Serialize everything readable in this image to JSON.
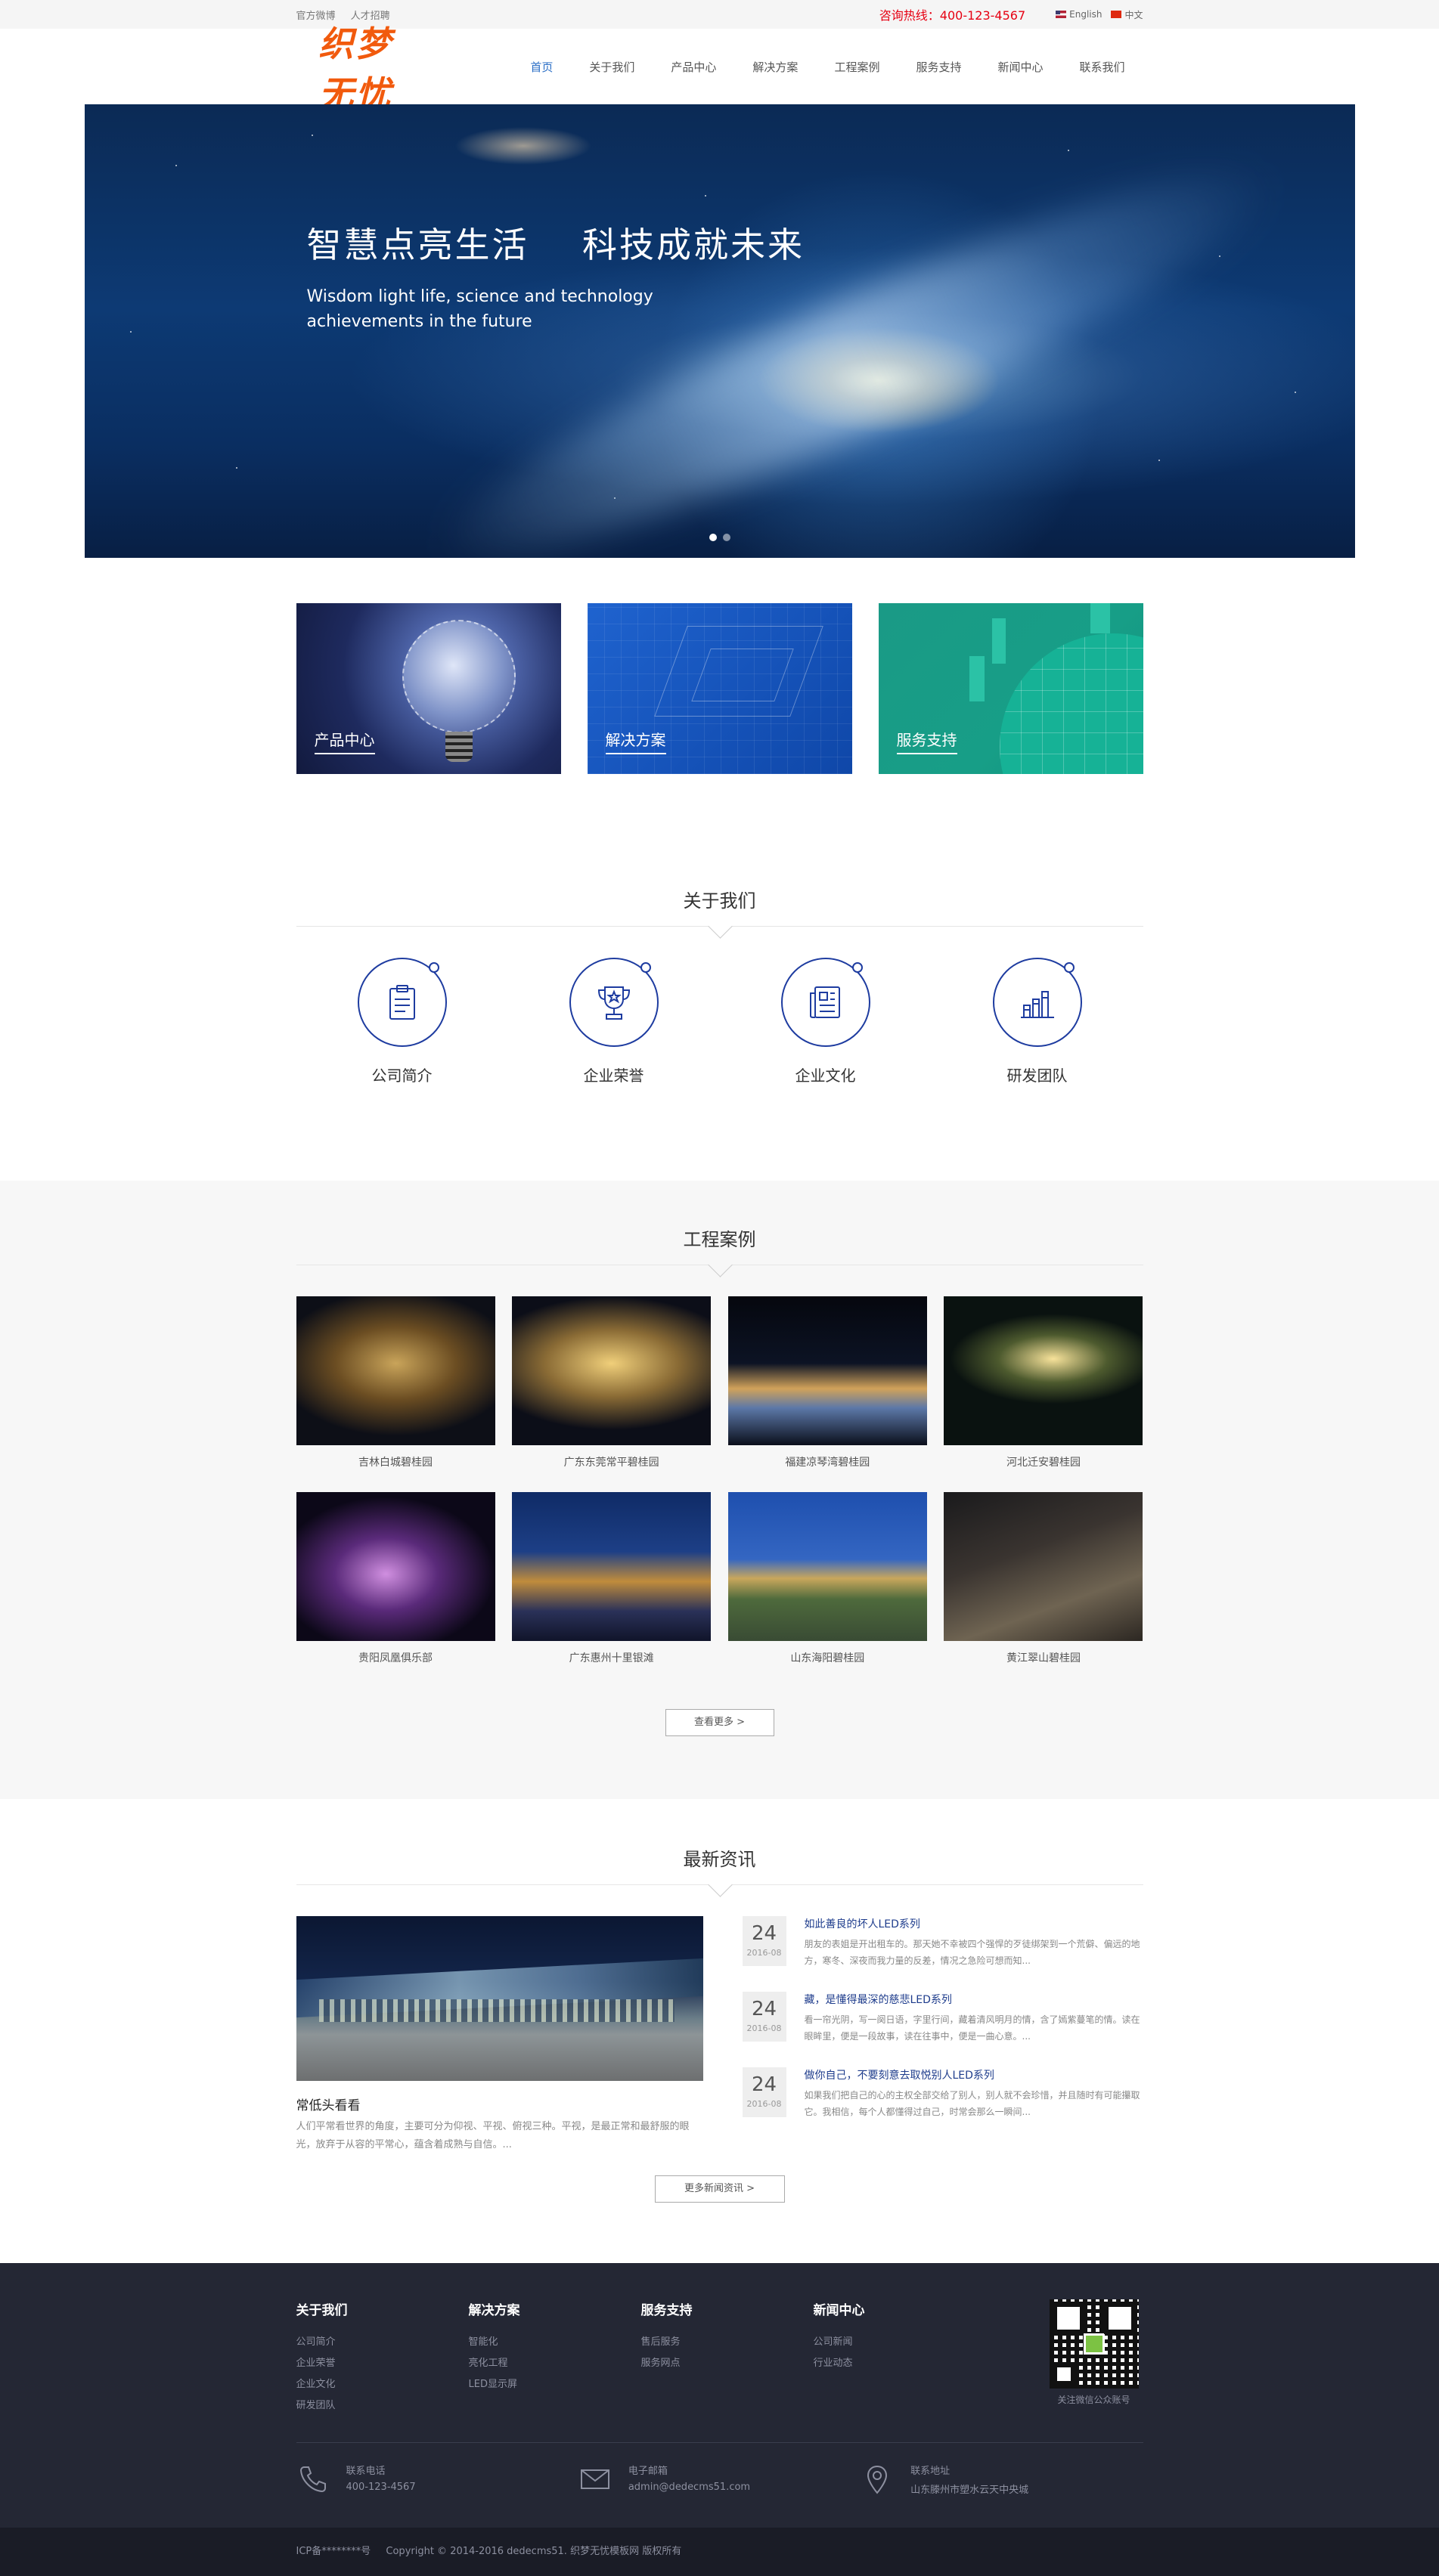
{
  "topbar": {
    "links": [
      "官方微博",
      "人才招聘"
    ],
    "hotline": "咨询热线：400-123-4567",
    "lang_en": "English",
    "lang_cn": "中文"
  },
  "header": {
    "logo": "织梦无忧",
    "nav": [
      "首页",
      "关于我们",
      "产品中心",
      "解决方案",
      "工程案例",
      "服务支持",
      "新闻中心",
      "联系我们"
    ]
  },
  "banner": {
    "title": "智慧点亮生活    科技成就未来",
    "subtitle": "Wisdom light life, science and technology achievements in the future"
  },
  "feature_cards": [
    "产品中心",
    "解决方案",
    "服务支持"
  ],
  "about": {
    "title": "关于我们",
    "items": [
      {
        "label": "公司简介",
        "icon": "clipboard-icon"
      },
      {
        "label": "企业荣誉",
        "icon": "trophy-icon"
      },
      {
        "label": "企业文化",
        "icon": "newspaper-icon"
      },
      {
        "label": "研发团队",
        "icon": "bar-chart-icon"
      }
    ]
  },
  "cases": {
    "title": "工程案例",
    "items": [
      "吉林白城碧桂园",
      "广东东莞常平碧桂园",
      "福建凉琴湾碧桂园",
      "河北迁安碧桂园",
      "贵阳凤凰俱乐部",
      "广东惠州十里银滩",
      "山东海阳碧桂园",
      "黄江翠山碧桂园"
    ],
    "more": "查看更多 >"
  },
  "news": {
    "title": "最新资讯",
    "featured": {
      "title": "常低头看看",
      "summary": "人们平常看世界的角度，主要可分为仰视、平视、俯视三种。平视，是最正常和最舒服的眼光，放弃于从容的平常心，蕴含着成熟与自信。..."
    },
    "items": [
      {
        "day": "24",
        "ym": "2016-08",
        "title": "如此善良的坏人LED系列",
        "summary": "朋友的表姐是开出租车的。那天她不幸被四个强悍的歹徒绑架到一个荒僻、偏远的地方，寒冬、深夜而我力量的反差，情况之急险可想而知..."
      },
      {
        "day": "24",
        "ym": "2016-08",
        "title": "藏，是懂得最深的慈悲LED系列",
        "summary": "看一帘光阴，写一阕日语，字里行间，藏着清风明月的情，含了嫣紫蔓笔的情。读在眼眸里，便是一段故事，读在往事中，便是一曲心意。..."
      },
      {
        "day": "24",
        "ym": "2016-08",
        "title": "做你自己，不要刻意去取悦别人LED系列",
        "summary": "如果我们把自己的心的主权全部交给了别人，别人就不会珍惜，并且随时有可能攥取它。我相信，每个人都懂得过自己，时常会那么一瞬间..."
      }
    ],
    "more": "更多新闻资讯 >"
  },
  "footer": {
    "columns": [
      {
        "title": "关于我们",
        "items": [
          "公司简介",
          "企业荣誉",
          "企业文化",
          "研发团队"
        ]
      },
      {
        "title": "解决方案",
        "items": [
          "智能化",
          "亮化工程",
          "LED显示屏"
        ]
      },
      {
        "title": "服务支持",
        "items": [
          "售后服务",
          "服务网点"
        ]
      },
      {
        "title": "新闻中心",
        "items": [
          "公司新闻",
          "行业动态"
        ]
      }
    ],
    "qr_caption": "关注微信公众账号",
    "contacts": [
      {
        "label": "联系电话",
        "value": "400-123-4567",
        "icon": "phone-icon"
      },
      {
        "label": "电子邮箱",
        "value": "admin@dedecms51.com",
        "icon": "mail-icon"
      },
      {
        "label": "联系地址",
        "value": "山东滕州市塑水云天中央城",
        "icon": "location-icon"
      }
    ],
    "icp": "ICP备********号",
    "copyright": "Copyright © 2014-2016 dedecms51. 织梦无忧模板网 版权所有"
  },
  "colors": {
    "accent": "#2a6ec6",
    "hotline": "#e60012",
    "logo": "#f15a0d",
    "icon_stroke": "#1e3ca0",
    "footer_bg": "#242734"
  }
}
